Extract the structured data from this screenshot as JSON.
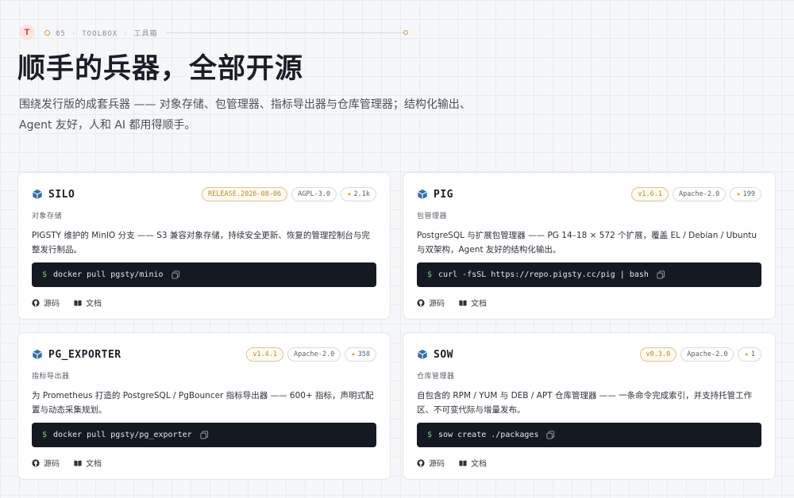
{
  "header": {
    "avatar_letter": "T",
    "section_number": "05",
    "section_label": "TOOLBOX",
    "section_label_cn": "工具箱",
    "title": "顺手的兵器，全部开源",
    "description": "围绕发行版的成套兵器 —— 对象存储、包管理器、指标导出器与仓库管理器；结构化输出、Agent 友好，人和 AI 都用得顺手。"
  },
  "colors": {
    "accent": "#d89a3a",
    "brand": "#2f6fb3",
    "terminal_bg": "#151921",
    "prompt": "#7ec27e"
  },
  "cards": [
    {
      "name": "SILO",
      "category": "对象存储",
      "tags": [
        "RELEASE.2026-08-06",
        "AGPL-3.0"
      ],
      "stars": "2.1k",
      "description": "PIGSTY 维护的 MinIO 分支 —— S3 兼容对象存储，持续安全更新、恢复的管理控制台与完整发行制品。",
      "prompt": "$",
      "command": "docker pull pgsty/minio",
      "links": [
        "源码",
        "文档"
      ]
    },
    {
      "name": "PIG",
      "category": "包管理器",
      "tags": [
        "v1.6.1",
        "Apache-2.0"
      ],
      "stars": "199",
      "description": "PostgreSQL 与扩展包管理器 —— PG 14–18 × 572 个扩展，覆盖 EL / Debian / Ubuntu 与双架构，Agent 友好的结构化输出。",
      "prompt": "$",
      "command": "curl -fsSL https://repo.pigsty.cc/pig | bash",
      "links": [
        "源码",
        "文档"
      ]
    },
    {
      "name": "PG_EXPORTER",
      "category": "指标导出器",
      "tags": [
        "v1.4.1",
        "Apache-2.0"
      ],
      "stars": "358",
      "description": "为 Prometheus 打造的 PostgreSQL / PgBouncer 指标导出器 —— 600+ 指标，声明式配置与动态采集规划。",
      "prompt": "$",
      "command": "docker pull pgsty/pg_exporter",
      "links": [
        "源码",
        "文档"
      ]
    },
    {
      "name": "SOW",
      "category": "仓库管理器",
      "tags": [
        "v0.3.0",
        "Apache-2.0"
      ],
      "stars": "1",
      "description": "自包含的 RPM / YUM 与 DEB / APT 仓库管理器 —— 一条命令完成索引，并支持托管工作区、不可变代际与增量发布。",
      "prompt": "$",
      "command": "sow create ./packages",
      "links": [
        "源码",
        "文档"
      ]
    }
  ]
}
